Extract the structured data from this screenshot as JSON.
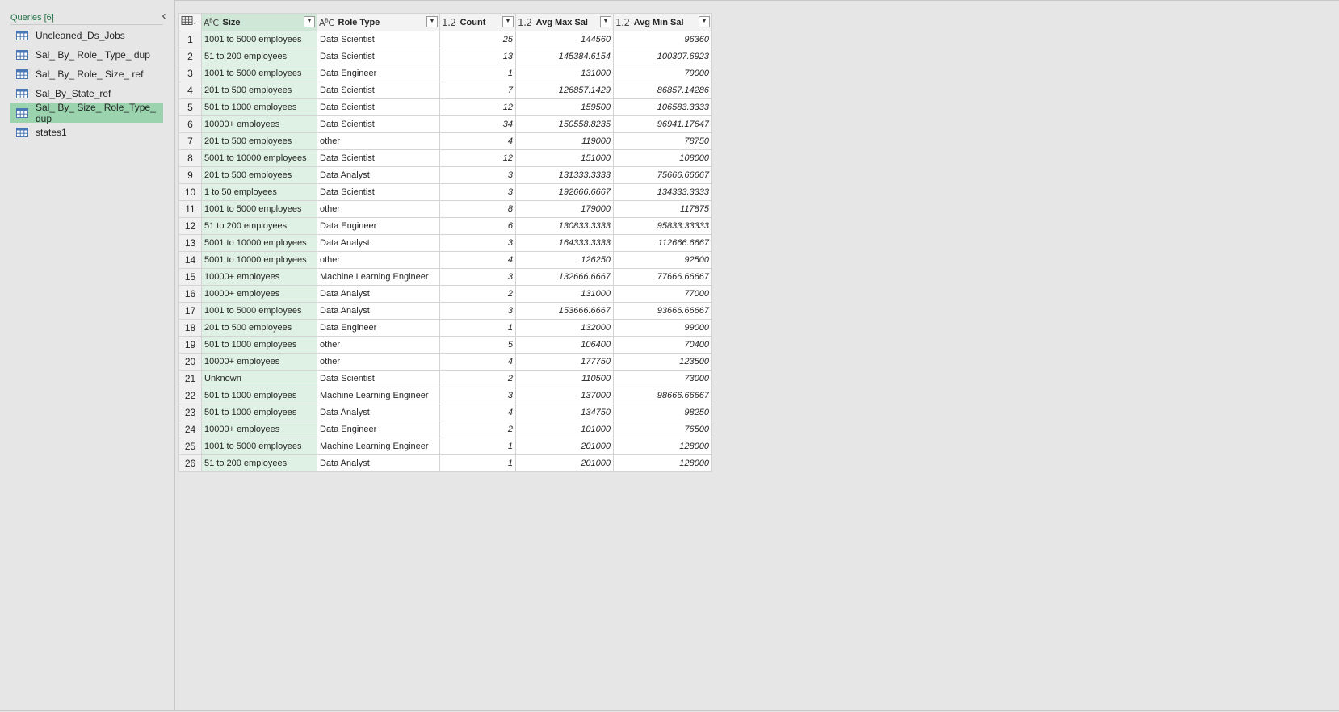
{
  "queries": {
    "header": "Queries [6]",
    "collapse_glyph": "‹",
    "items": [
      {
        "name": "Uncleaned_Ds_Jobs",
        "selected": false
      },
      {
        "name": "Sal_ By_ Role_ Type_ dup",
        "selected": false
      },
      {
        "name": "Sal_ By_ Role_ Size_ ref",
        "selected": false
      },
      {
        "name": "Sal_By_State_ref",
        "selected": false
      },
      {
        "name": "Sal_ By_ Size_ Role_Type_ dup",
        "selected": true
      },
      {
        "name": "states1",
        "selected": false
      }
    ]
  },
  "columns": [
    {
      "label": "Size",
      "type_icon": "ABC",
      "align": "left"
    },
    {
      "label": "Role Type",
      "type_icon": "ABC",
      "align": "left"
    },
    {
      "label": "Count",
      "type_icon": "1.2",
      "align": "right"
    },
    {
      "label": "Avg Max Sal",
      "type_icon": "1.2",
      "align": "right"
    },
    {
      "label": "Avg Min Sal",
      "type_icon": "1.2",
      "align": "right"
    }
  ],
  "rows": [
    [
      "1",
      "1001 to 5000 employees",
      "Data Scientist",
      "25",
      "144560",
      "96360"
    ],
    [
      "2",
      "51 to 200 employees",
      "Data Scientist",
      "13",
      "145384.6154",
      "100307.6923"
    ],
    [
      "3",
      "1001 to 5000 employees",
      "Data Engineer",
      "1",
      "131000",
      "79000"
    ],
    [
      "4",
      "201 to 500 employees",
      "Data Scientist",
      "7",
      "126857.1429",
      "86857.14286"
    ],
    [
      "5",
      "501 to 1000 employees",
      "Data Scientist",
      "12",
      "159500",
      "106583.3333"
    ],
    [
      "6",
      "10000+ employees",
      "Data Scientist",
      "34",
      "150558.8235",
      "96941.17647"
    ],
    [
      "7",
      "201 to 500 employees",
      "other",
      "4",
      "119000",
      "78750"
    ],
    [
      "8",
      "5001 to 10000 employees",
      "Data Scientist",
      "12",
      "151000",
      "108000"
    ],
    [
      "9",
      "201 to 500 employees",
      "Data Analyst",
      "3",
      "131333.3333",
      "75666.66667"
    ],
    [
      "10",
      "1 to 50 employees",
      "Data Scientist",
      "3",
      "192666.6667",
      "134333.3333"
    ],
    [
      "11",
      "1001 to 5000 employees",
      "other",
      "8",
      "179000",
      "117875"
    ],
    [
      "12",
      "51 to 200 employees",
      "Data Engineer",
      "6",
      "130833.3333",
      "95833.33333"
    ],
    [
      "13",
      "5001 to 10000 employees",
      "Data Analyst",
      "3",
      "164333.3333",
      "112666.6667"
    ],
    [
      "14",
      "5001 to 10000 employees",
      "other",
      "4",
      "126250",
      "92500"
    ],
    [
      "15",
      "10000+ employees",
      "Machine Learning Engineer",
      "3",
      "132666.6667",
      "77666.66667"
    ],
    [
      "16",
      "10000+ employees",
      "Data Analyst",
      "2",
      "131000",
      "77000"
    ],
    [
      "17",
      "1001 to 5000 employees",
      "Data Analyst",
      "3",
      "153666.6667",
      "93666.66667"
    ],
    [
      "18",
      "201 to 500 employees",
      "Data Engineer",
      "1",
      "132000",
      "99000"
    ],
    [
      "19",
      "501 to 1000 employees",
      "other",
      "5",
      "106400",
      "70400"
    ],
    [
      "20",
      "10000+ employees",
      "other",
      "4",
      "177750",
      "123500"
    ],
    [
      "21",
      "Unknown",
      "Data Scientist",
      "2",
      "110500",
      "73000"
    ],
    [
      "22",
      "501 to 1000 employees",
      "Machine Learning Engineer",
      "3",
      "137000",
      "98666.66667"
    ],
    [
      "23",
      "501 to 1000 employees",
      "Data Analyst",
      "4",
      "134750",
      "98250"
    ],
    [
      "24",
      "10000+ employees",
      "Data Engineer",
      "2",
      "101000",
      "76500"
    ],
    [
      "25",
      "1001 to 5000 employees",
      "Machine Learning Engineer",
      "1",
      "201000",
      "128000"
    ],
    [
      "26",
      "51 to 200 employees",
      "Data Analyst",
      "1",
      "201000",
      "128000"
    ]
  ],
  "colors": {
    "accent": "#217346",
    "selected_query_bg": "#9bd3ae",
    "selected_column_bg": "#dff0e4",
    "app_bg": "#e6e6e6"
  }
}
